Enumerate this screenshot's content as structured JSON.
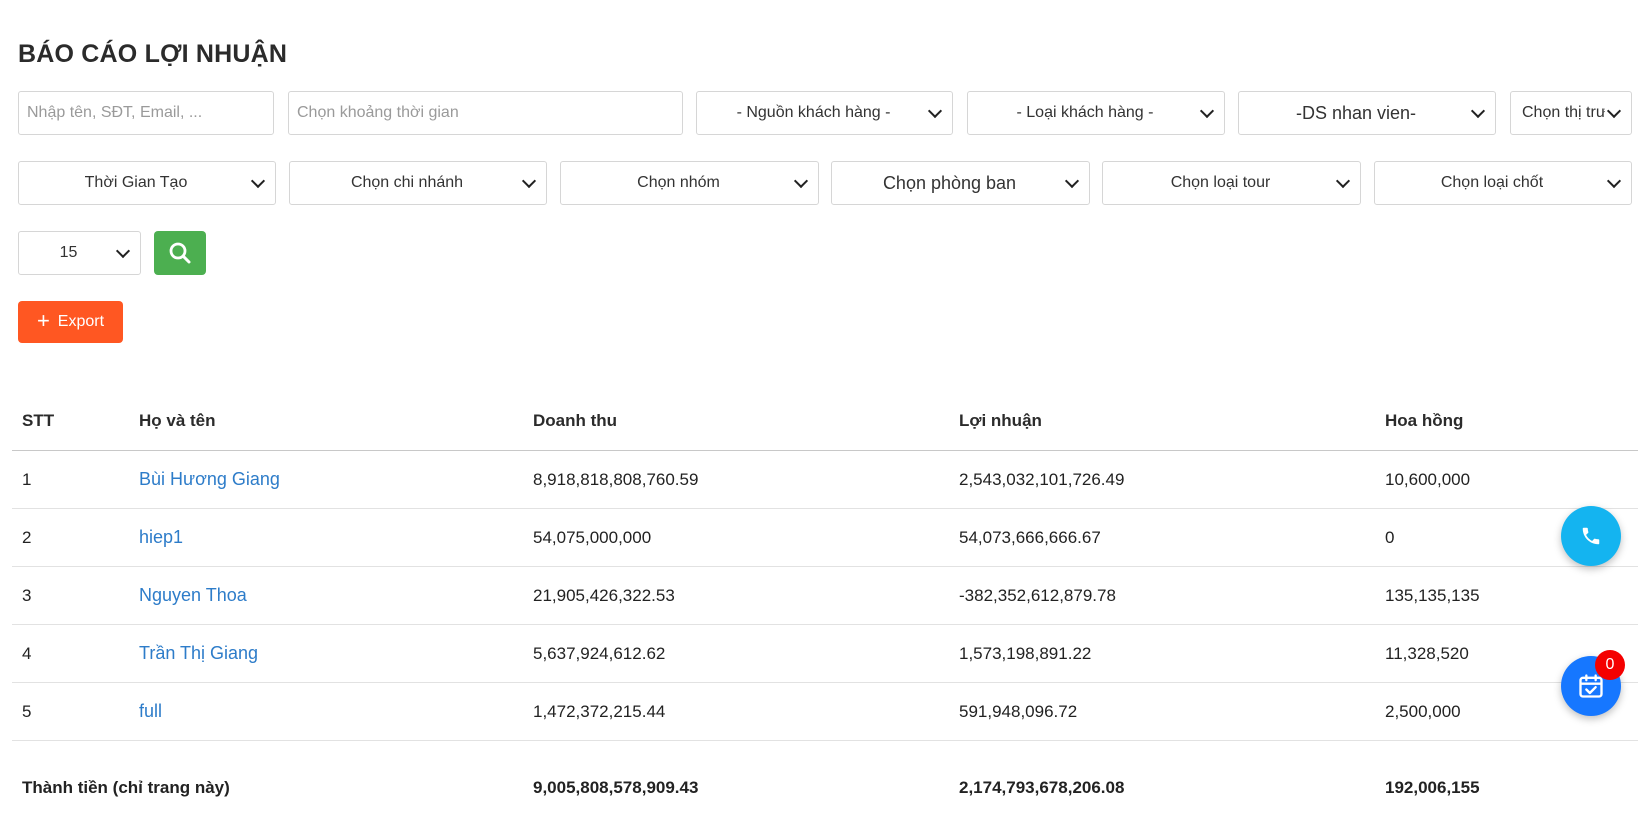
{
  "page": {
    "title": "BÁO CÁO LỢI NHUẬN"
  },
  "filters": {
    "keyword_placeholder": "Nhập tên, SĐT, Email, ...",
    "date_range_placeholder": "Chọn khoảng thời gian",
    "customer_source": "- Nguồn khách hàng -",
    "customer_type": "- Loại khách hàng -",
    "staff_list": "-DS nhan vien-",
    "market": "Chọn thị trư",
    "time_created": "Thời Gian Tạo",
    "branch": "Chọn chi nhánh",
    "group": "Chọn nhóm",
    "department": "Chọn phòng ban",
    "tour_type": "Chọn loại tour",
    "closing_type": "Chọn loại chốt",
    "page_size": "15"
  },
  "actions": {
    "search_icon": "search-icon",
    "export_label": "Export",
    "export_icon": "+"
  },
  "table": {
    "headers": [
      "STT",
      "Họ và tên",
      "Doanh thu",
      "Lợi nhuận",
      "Hoa hồng"
    ],
    "rows": [
      {
        "stt": "1",
        "name": "Bùi Hương Giang",
        "revenue": "8,918,818,808,760.59",
        "profit": "2,543,032,101,726.49",
        "commission": "10,600,000"
      },
      {
        "stt": "2",
        "name": "hiep1",
        "revenue": "54,075,000,000",
        "profit": "54,073,666,666.67",
        "commission": "0"
      },
      {
        "stt": "3",
        "name": "Nguyen Thoa",
        "revenue": "21,905,426,322.53",
        "profit": "-382,352,612,879.78",
        "commission": "135,135,135"
      },
      {
        "stt": "4",
        "name": "Trần Thị Giang",
        "revenue": "5,637,924,612.62",
        "profit": "1,573,198,891.22",
        "commission": "11,328,520"
      },
      {
        "stt": "5",
        "name": "full",
        "revenue": "1,472,372,215.44",
        "profit": "591,948,096.72",
        "commission": "2,500,000"
      }
    ],
    "total": {
      "label": "Thành tiền (chỉ trang này)",
      "revenue": "9,005,808,578,909.43",
      "profit": "2,174,793,678,206.08",
      "commission": "192,006,155"
    }
  },
  "floating": {
    "phone_icon": "phone-icon",
    "calendar_icon": "calendar-check-icon",
    "calendar_badge": "0"
  },
  "colors": {
    "search_button": "#4caf50",
    "export_button": "#ff5722",
    "link": "#2d7cc9",
    "phone_fab": "#14b4f0",
    "calendar_fab": "#1677ff",
    "badge": "#f40000"
  }
}
